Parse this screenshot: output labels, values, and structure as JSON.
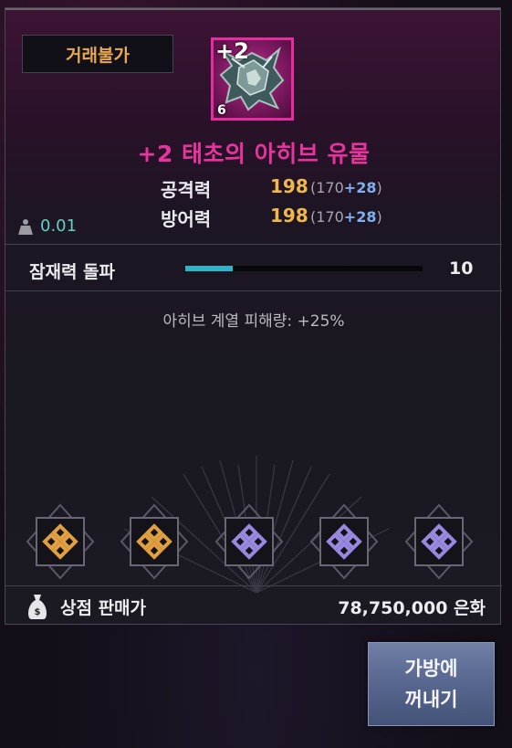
{
  "tooltip": {
    "trade_badge": "거래불가",
    "item": {
      "upgrade_label": "+2",
      "quantity": "6",
      "name": "+2 태초의 아히브 유물",
      "grade_color": "#e8339e"
    },
    "stats": [
      {
        "label": "공격력",
        "value": "198",
        "base": "(170",
        "bonus": "+28",
        "close": ")"
      },
      {
        "label": "방어력",
        "value": "198",
        "base": "(170",
        "bonus": "+28",
        "close": ")"
      }
    ],
    "weight": "0.01",
    "potential": {
      "label": "잠재력 돌파",
      "value": "10",
      "fill_fraction": 0.2
    },
    "effect_text": "아히브 계열 피해량: +25%",
    "slots": [
      {
        "icon": "gold-knot-icon",
        "color": "#e0a040"
      },
      {
        "icon": "gold-knot-icon",
        "color": "#e0a040"
      },
      {
        "icon": "purple-knot-icon",
        "color": "#9a88e0"
      },
      {
        "icon": "purple-knot-icon",
        "color": "#9a88e0"
      },
      {
        "icon": "purple-knot-icon",
        "color": "#9a88e0"
      }
    ],
    "sale": {
      "label": "상점 판매가",
      "value": "78,750,000 은화"
    }
  },
  "take_button": {
    "line1": "가방에",
    "line2": "꺼내기"
  }
}
